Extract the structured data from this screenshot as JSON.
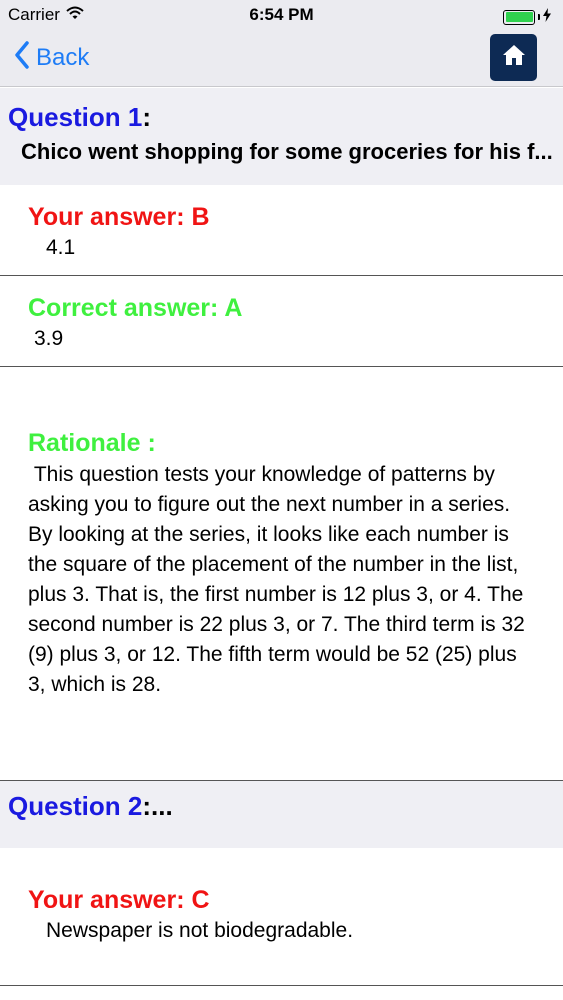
{
  "status_bar": {
    "carrier": "Carrier",
    "time": "6:54 PM",
    "battery_color": "#2fd14e"
  },
  "nav": {
    "back_label": "Back",
    "back_icon": "chevron-left-icon",
    "home_icon": "home-icon",
    "accent_color": "#1e7cf6",
    "home_button_color": "#0d2a54"
  },
  "questions": [
    {
      "title": "Question 1",
      "title_suffix": ":",
      "text": "Chico went shopping for some groceries for his f...",
      "your_answer_label": "Your answer: B",
      "your_answer_text": "4.1",
      "correct_answer_label": "Correct answer: A",
      "correct_answer_text": "3.9",
      "rationale_label": "Rationale :",
      "rationale_text": " This question tests your knowledge of patterns by asking you to figure out the next number in a series. By looking at the series, it looks like each number is the square of the placement of the number in the list, plus 3. That is, the first number is 12 plus 3, or 4. The second number is 22 plus 3, or 7. The third term is 32 (9) plus 3, or 12. The fifth term would be 52 (25) plus 3, which is 28."
    },
    {
      "title": "Question 2",
      "title_suffix": ":...",
      "your_answer_label": "Your answer: C",
      "your_answer_text": "Newspaper is not biodegradable."
    }
  ],
  "colors": {
    "question_title": "#1a1ae0",
    "wrong_answer": "#f01414",
    "correct_answer": "#3ff03f",
    "header_background": "#efeff4"
  }
}
